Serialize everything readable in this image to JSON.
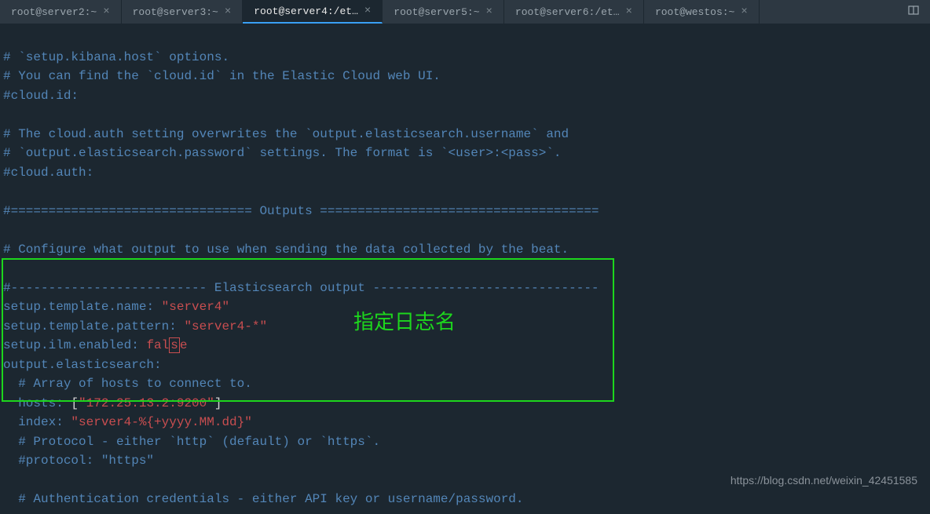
{
  "tabs": [
    {
      "label": "root@server2:~",
      "active": false
    },
    {
      "label": "root@server3:~",
      "active": false
    },
    {
      "label": "root@server4:/et…",
      "active": true
    },
    {
      "label": "root@server5:~",
      "active": false
    },
    {
      "label": "root@server6:/et…",
      "active": false
    },
    {
      "label": "root@westos:~",
      "active": false
    }
  ],
  "config": {
    "line1": "# `setup.kibana.host` options.",
    "line2": "# You can find the `cloud.id` in the Elastic Cloud web UI.",
    "line3": "#cloud.id:",
    "line4": "",
    "line5": "# The cloud.auth setting overwrites the `output.elasticsearch.username` and",
    "line6": "# `output.elasticsearch.password` settings. The format is `<user>:<pass>`.",
    "line7": "#cloud.auth:",
    "line8": "",
    "line9": "#================================ Outputs =====================================",
    "line10": "",
    "line11": "# Configure what output to use when sending the data collected by the beat.",
    "line12": "",
    "line13": "#-------------------------- Elasticsearch output ------------------------------",
    "templateName": {
      "key": "setup.template.name",
      "value": "\"server4\""
    },
    "templatePattern": {
      "key": "setup.template.pattern",
      "value": "\"server4-*\""
    },
    "ilmEnabled": {
      "key": "setup.ilm.enabled",
      "value_pre": "fal",
      "value_cursor": "s",
      "value_post": "e"
    },
    "outputEs": {
      "key": "output.elasticsearch",
      "colon": ":"
    },
    "arrayComment": "  # Array of hosts to connect to.",
    "hosts": {
      "indent": "  ",
      "key": "hosts",
      "bracket_open": "[",
      "value": "\"172.25.13.2:9200\"",
      "bracket_close": "]"
    },
    "index": {
      "indent": "  ",
      "key": "index",
      "value": "\"server4-%{+yyyy.MM.dd}\""
    },
    "protocolComment1": "  # Protocol - either `http` (default) or `https`.",
    "protocolComment2": "  #protocol: \"https\"",
    "line_blank": "",
    "authComment": "  # Authentication credentials - either API key or username/password."
  },
  "annotation": "指定日志名",
  "watermark": "https://blog.csdn.net/weixin_42451585"
}
